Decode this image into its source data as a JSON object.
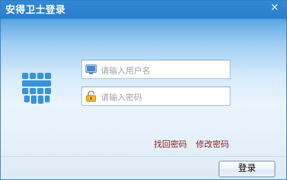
{
  "window": {
    "title": "安得卫士登录",
    "close_glyph": "×"
  },
  "logo": {
    "icon": "app-logo-icon"
  },
  "form": {
    "username": {
      "placeholder": "请输入用户名",
      "value": "",
      "icon": "monitor-icon"
    },
    "password": {
      "placeholder": "请输入密码",
      "value": "",
      "icon": "lock-icon"
    }
  },
  "links": {
    "recover_password": "找回密码",
    "change_password": "修改密码"
  },
  "buttons": {
    "login": "登录"
  },
  "colors": {
    "title_bar": "#2a7fcd",
    "link": "#8b1d1d",
    "logo": "#3a93d8"
  }
}
